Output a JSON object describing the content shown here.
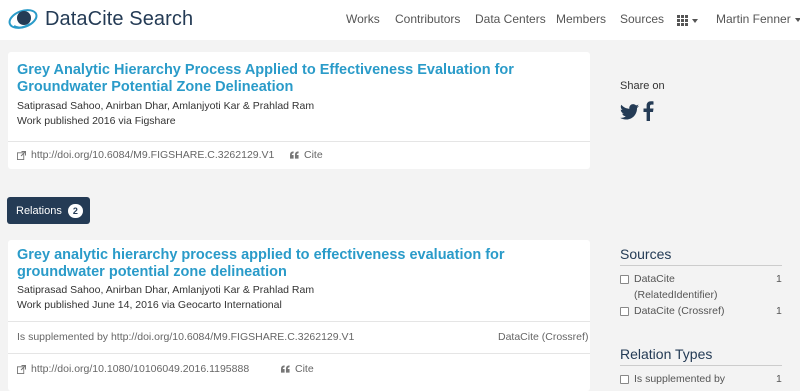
{
  "nav": {
    "brand": "DataCite Search",
    "items": [
      "Works",
      "Contributors",
      "Data Centers",
      "Members",
      "Sources"
    ],
    "user": "Martin Fenner"
  },
  "work": {
    "title_line1": "Grey Analytic Hierarchy Process Applied to Effectiveness Evaluation for",
    "title_line2": "Groundwater Potential Zone Delineation",
    "authors": "Satiprasad Sahoo, Anirban Dhar, Amlanjyoti Kar & Prahlad Ram",
    "published": "Work published 2016 via Figshare",
    "doi": "http://doi.org/10.6084/M9.FIGSHARE.C.3262129.V1",
    "cite": "Cite"
  },
  "relations": {
    "label": "Relations",
    "count": "2"
  },
  "related": {
    "title_line1": "Grey analytic hierarchy process applied to effectiveness evaluation for",
    "title_line2": "groundwater potential zone delineation",
    "authors": "Satiprasad Sahoo, Anirban Dhar, Amlanjyoti Kar & Prahlad Ram",
    "published": "Work published June 14, 2016 via Geocarto International",
    "relation": "Is supplemented by http://doi.org/10.6084/M9.FIGSHARE.C.3262129.V1",
    "source": "DataCite (Crossref)",
    "doi": "http://doi.org/10.1080/10106049.2016.1195888",
    "cite": "Cite"
  },
  "sidebar": {
    "share_label": "Share on",
    "sources_heading": "Sources",
    "sources": [
      {
        "label_line1": "DataCite",
        "label_line2": "(RelatedIdentifier)",
        "count": "1"
      },
      {
        "label_line1": "DataCite (Crossref)",
        "count": "1"
      }
    ],
    "relation_types_heading": "Relation Types",
    "relation_types": [
      {
        "label": "Is supplemented by",
        "count": "1"
      }
    ]
  },
  "colors": {
    "brand": "#243b55",
    "link": "#2a9bc9",
    "background": "#f3f3f3"
  }
}
